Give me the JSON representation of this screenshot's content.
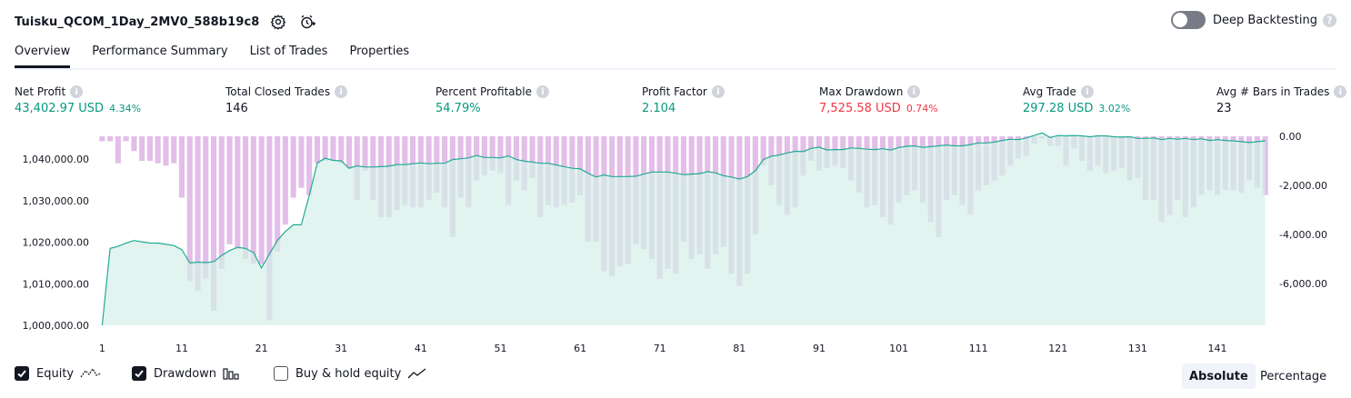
{
  "header": {
    "title": "Tuisku_QCOM_1Day_2MV0_588b19c8",
    "deep_backtesting_label": "Deep Backtesting"
  },
  "tabs": [
    {
      "label": "Overview",
      "active": true
    },
    {
      "label": "Performance Summary",
      "active": false
    },
    {
      "label": "List of Trades",
      "active": false
    },
    {
      "label": "Properties",
      "active": false
    }
  ],
  "metrics": [
    {
      "label": "Net Profit",
      "value": "43,402.97 USD",
      "sub": "4.34%",
      "tone": "pos"
    },
    {
      "label": "Total Closed Trades",
      "value": "146",
      "sub": "",
      "tone": "neu"
    },
    {
      "label": "Percent Profitable",
      "value": "54.79%",
      "sub": "",
      "tone": "pos"
    },
    {
      "label": "Profit Factor",
      "value": "2.104",
      "sub": "",
      "tone": "pos"
    },
    {
      "label": "Max Drawdown",
      "value": "7,525.58 USD",
      "sub": "0.74%",
      "tone": "neg"
    },
    {
      "label": "Avg Trade",
      "value": "297.28 USD",
      "sub": "3.02%",
      "tone": "pos"
    },
    {
      "label": "Avg # Bars in Trades",
      "value": "23",
      "sub": "",
      "tone": "neu"
    }
  ],
  "legend": {
    "equity_label": "Equity",
    "drawdown_label": "Drawdown",
    "buyhold_label": "Buy & hold equity",
    "equity_checked": true,
    "drawdown_checked": true,
    "buyhold_checked": false
  },
  "modes": {
    "absolute_label": "Absolute",
    "percentage_label": "Percentage",
    "active": "Absolute"
  },
  "colors": {
    "equity_line": "#22ab94",
    "equity_fill": "#d5f0e8",
    "drawdown_bar": "#ce93d8",
    "profit": "#089981",
    "loss": "#f23645"
  },
  "chart_data": {
    "type": "area",
    "x": [
      1,
      2,
      3,
      4,
      5,
      6,
      7,
      8,
      9,
      10,
      11,
      12,
      13,
      14,
      15,
      16,
      17,
      18,
      19,
      20,
      21,
      22,
      23,
      24,
      25,
      26,
      27,
      28,
      29,
      30,
      31,
      32,
      33,
      34,
      35,
      36,
      37,
      38,
      39,
      40,
      41,
      42,
      43,
      44,
      45,
      46,
      47,
      48,
      49,
      50,
      51,
      52,
      53,
      54,
      55,
      56,
      57,
      58,
      59,
      60,
      61,
      62,
      63,
      64,
      65,
      66,
      67,
      68,
      69,
      70,
      71,
      72,
      73,
      74,
      75,
      76,
      77,
      78,
      79,
      80,
      81,
      82,
      83,
      84,
      85,
      86,
      87,
      88,
      89,
      90,
      91,
      92,
      93,
      94,
      95,
      96,
      97,
      98,
      99,
      100,
      101,
      102,
      103,
      104,
      105,
      106,
      107,
      108,
      109,
      110,
      111,
      112,
      113,
      114,
      115,
      116,
      117,
      118,
      119,
      120,
      121,
      122,
      123,
      124,
      125,
      126,
      127,
      128,
      129,
      130,
      131,
      132,
      133,
      134,
      135,
      136,
      137,
      138,
      139,
      140,
      141,
      142,
      143,
      144,
      145,
      146,
      147
    ],
    "x_ticks": [
      "1",
      "11",
      "21",
      "31",
      "41",
      "51",
      "61",
      "71",
      "81",
      "91",
      "101",
      "111",
      "121",
      "131",
      "141"
    ],
    "series": [
      {
        "name": "Equity",
        "axis": "left",
        "values": [
          1000000,
          1018500,
          1019000,
          1019800,
          1020400,
          1020100,
          1019800,
          1019800,
          1019500,
          1019200,
          1018200,
          1015000,
          1015200,
          1015100,
          1015300,
          1016800,
          1018000,
          1018800,
          1018500,
          1017500,
          1013800,
          1017200,
          1020400,
          1022600,
          1024200,
          1024200,
          1031300,
          1039100,
          1040200,
          1039700,
          1039600,
          1037800,
          1038400,
          1038100,
          1038100,
          1038200,
          1038300,
          1038700,
          1038700,
          1038900,
          1039100,
          1038900,
          1039000,
          1039000,
          1039900,
          1040100,
          1040300,
          1040900,
          1040400,
          1040400,
          1040300,
          1040800,
          1039900,
          1039500,
          1039300,
          1039000,
          1039000,
          1038600,
          1038200,
          1037800,
          1037700,
          1036600,
          1035700,
          1036200,
          1035800,
          1035800,
          1035800,
          1035900,
          1036400,
          1036900,
          1036900,
          1036900,
          1036600,
          1036300,
          1036400,
          1036500,
          1037000,
          1036700,
          1036000,
          1035700,
          1035200,
          1035800,
          1037200,
          1039900,
          1040700,
          1041000,
          1041500,
          1041900,
          1041800,
          1042600,
          1042900,
          1042200,
          1042300,
          1042300,
          1042700,
          1042600,
          1042400,
          1042300,
          1042500,
          1042200,
          1042800,
          1043100,
          1043200,
          1042800,
          1043000,
          1043200,
          1043400,
          1043200,
          1043200,
          1043500,
          1043900,
          1043900,
          1044100,
          1044500,
          1044800,
          1044700,
          1045100,
          1045700,
          1046300,
          1045200,
          1045700,
          1045600,
          1045700,
          1045600,
          1045400,
          1045600,
          1045600,
          1045400,
          1045300,
          1045400,
          1045000,
          1045000,
          1045100,
          1044700,
          1045000,
          1044800,
          1045000,
          1044700,
          1044900,
          1044500,
          1044700,
          1044500,
          1044400,
          1044200,
          1044000,
          1044200,
          1044400
        ]
      },
      {
        "name": "Drawdown",
        "axis": "right",
        "values": [
          -200,
          -200,
          -1100,
          -200,
          -600,
          -1000,
          -1000,
          -1100,
          -1200,
          -1100,
          -2500,
          -5900,
          -6300,
          -5800,
          -7100,
          -5400,
          -4400,
          -4600,
          -5000,
          -5200,
          -5200,
          -7500,
          -4700,
          -3600,
          -2500,
          -2100,
          -2400,
          -1100,
          -1000,
          -1000,
          -1100,
          -1300,
          -2600,
          -1400,
          -2600,
          -3300,
          -3300,
          -3000,
          -2800,
          -2900,
          -2900,
          -2600,
          -2300,
          -2900,
          -4100,
          -2500,
          -2900,
          -1800,
          -1600,
          -1400,
          -1500,
          -2800,
          -1800,
          -2200,
          -1700,
          -3300,
          -2800,
          -2900,
          -2800,
          -2700,
          -2400,
          -4300,
          -4300,
          -5500,
          -5700,
          -5300,
          -5200,
          -4400,
          -4600,
          -5000,
          -5800,
          -5400,
          -5600,
          -4300,
          -5000,
          -4800,
          -5400,
          -4800,
          -4500,
          -5600,
          -6100,
          -5600,
          -4000,
          -1200,
          -2000,
          -2800,
          -3200,
          -2900,
          -1600,
          -1000,
          -1400,
          -1300,
          -1200,
          -1300,
          -1800,
          -2300,
          -2900,
          -2800,
          -3300,
          -3600,
          -2700,
          -2400,
          -2200,
          -2700,
          -3500,
          -4100,
          -2600,
          -2400,
          -2800,
          -3200,
          -2200,
          -2000,
          -1800,
          -1600,
          -1200,
          -900,
          -800,
          -300,
          -100,
          -400,
          -400,
          -1200,
          -500,
          -1000,
          -1400,
          -1200,
          -1500,
          -1400,
          -1300,
          -1800,
          -1700,
          -2600,
          -2600,
          -3500,
          -3200,
          -2600,
          -3300,
          -2900,
          -2400,
          -2200,
          -2400,
          -2200,
          -2200,
          -2300,
          -1800,
          -2100,
          -2400
        ]
      }
    ],
    "left_axis": {
      "ticks": [
        "1,000,000.00",
        "1,010,000.00",
        "1,020,000.00",
        "1,030,000.00",
        "1,040,000.00"
      ],
      "range": [
        1000000,
        1045500
      ]
    },
    "right_axis": {
      "ticks": [
        "0.00",
        "-2,000.00",
        "-4,000.00",
        "-6,000.00"
      ],
      "range": [
        -7700,
        0
      ]
    },
    "grid": false,
    "legend_position": "bottom-left"
  }
}
